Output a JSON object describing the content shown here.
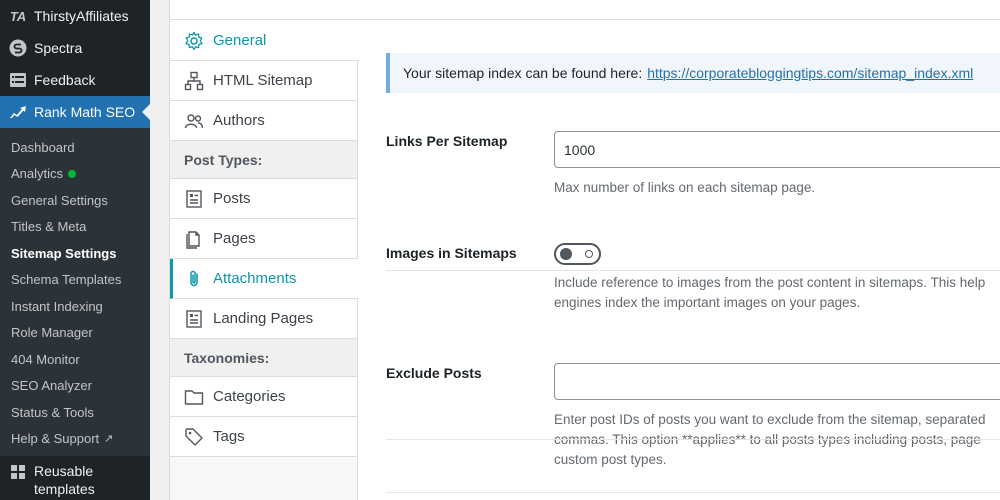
{
  "wp_menu": {
    "thirsty": "ThirstyAffiliates",
    "spectra": "Spectra",
    "feedback": "Feedback",
    "rankmath": "Rank Math SEO",
    "reusable": "Reusable templates"
  },
  "rankmath_submenu": [
    "Dashboard",
    "Analytics",
    "General Settings",
    "Titles & Meta",
    "Sitemap Settings",
    "Schema Templates",
    "Instant Indexing",
    "Role Manager",
    "404 Monitor",
    "SEO Analyzer",
    "Status & Tools",
    "Help & Support"
  ],
  "tabs": {
    "general": "General",
    "html_sitemap": "HTML Sitemap",
    "authors": "Authors",
    "post_types_heading": "Post Types:",
    "posts": "Posts",
    "pages": "Pages",
    "attachments": "Attachments",
    "landing_pages": "Landing Pages",
    "taxonomies_heading": "Taxonomies:",
    "categories": "Categories",
    "tags": "Tags"
  },
  "notice": {
    "text": "Your sitemap index can be found here:",
    "link": "https://corporatebloggingtips.com/sitemap_index.xml"
  },
  "settings": {
    "links_per_sitemap": {
      "label": "Links Per Sitemap",
      "value": "1000",
      "description": "Max number of links on each sitemap page."
    },
    "images_in_sitemaps": {
      "label": "Images in Sitemaps",
      "enabled": false,
      "description_line1": "Include reference to images from the post content in sitemaps. This help",
      "description_line2": "engines index the important images on your pages."
    },
    "exclude_posts": {
      "label": "Exclude Posts",
      "value": "",
      "description_line1": "Enter post IDs of posts you want to exclude from the sitemap, separated",
      "description_line2": "commas. This option **applies** to all posts types including posts, page",
      "description_line3": "custom post types."
    }
  },
  "colors": {
    "accent": "#0a97b0",
    "wp_blue": "#2271b1",
    "sidebar_bg": "#1d2327",
    "analytics_dot": "#00ba37"
  }
}
